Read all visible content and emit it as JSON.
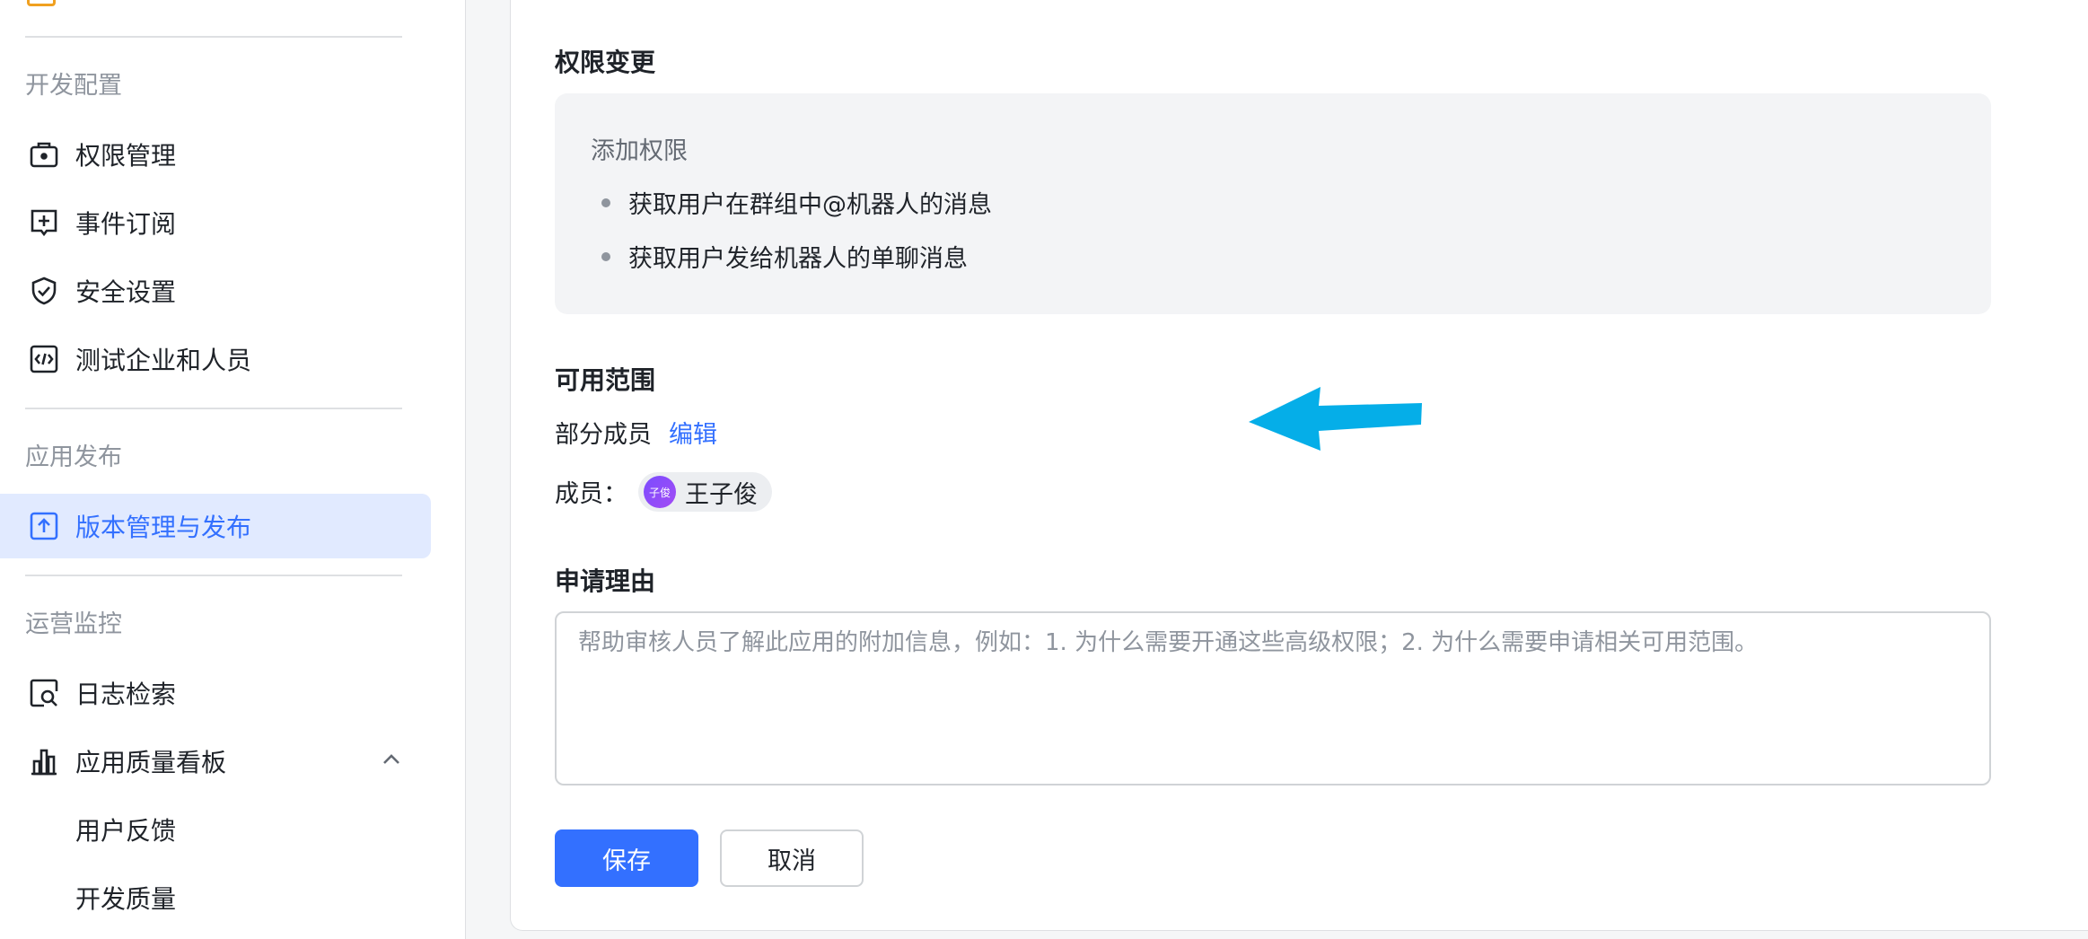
{
  "sidebar": {
    "sections": {
      "dev_config": "开发配置",
      "app_release": "应用发布",
      "ops_monitor": "运营监控"
    },
    "items": [
      {
        "label": "权限管理",
        "icon": "briefcase-lock-icon"
      },
      {
        "label": "事件订阅",
        "icon": "event-plus-icon"
      },
      {
        "label": "安全设置",
        "icon": "shield-check-icon"
      },
      {
        "label": "测试企业和人员",
        "icon": "code-box-icon"
      },
      {
        "label": "版本管理与发布",
        "icon": "upload-box-icon",
        "active": true
      },
      {
        "label": "日志检索",
        "icon": "log-search-icon"
      },
      {
        "label": "应用质量看板",
        "icon": "bar-chart-icon",
        "expanded": true
      },
      {
        "label": "用户反馈"
      },
      {
        "label": "开发质量"
      }
    ]
  },
  "main": {
    "permission_change": {
      "title": "权限变更",
      "add_title": "添加权限",
      "items": [
        "获取用户在群组中@机器人的消息",
        "获取用户发给机器人的单聊消息"
      ]
    },
    "scope": {
      "title": "可用范围",
      "value": "部分成员",
      "edit_label": "编辑",
      "members_label": "成员：",
      "members": [
        {
          "avatar_text": "子俊",
          "name": "王子俊"
        }
      ]
    },
    "reason": {
      "title": "申请理由",
      "placeholder": "帮助审核人员了解此应用的附加信息，例如：1. 为什么需要开通这些高级权限；2. 为什么需要申请相关可用范围。",
      "value": ""
    },
    "buttons": {
      "save": "保存",
      "cancel": "取消"
    }
  },
  "colors": {
    "accent": "#3370ff",
    "active_bg": "#e1eaff",
    "annotation_arrow": "#05aee8"
  }
}
